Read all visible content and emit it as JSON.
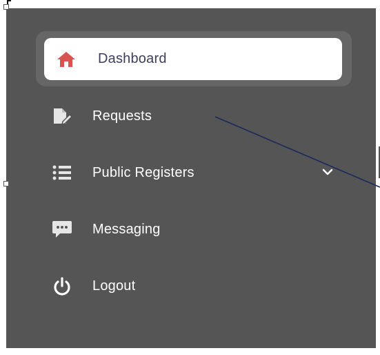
{
  "sidebar": {
    "items": [
      {
        "label": "Dashboard",
        "icon": "home-icon",
        "active": true
      },
      {
        "label": "Requests",
        "icon": "edit-document-icon"
      },
      {
        "label": "Public Registers",
        "icon": "list-icon",
        "expandable": true
      },
      {
        "label": "Messaging",
        "icon": "chat-bubble-icon"
      },
      {
        "label": "Logout",
        "icon": "power-icon"
      }
    ]
  },
  "colors": {
    "sidebar_bg": "#555555",
    "active_outline": "#666666",
    "active_bg": "#ffffff",
    "active_icon": "#d9534f",
    "active_text": "#3d3d5c",
    "item_text": "#ffffff",
    "item_icon": "#e6e6e6",
    "annotation_line": "#1a2a5a"
  }
}
